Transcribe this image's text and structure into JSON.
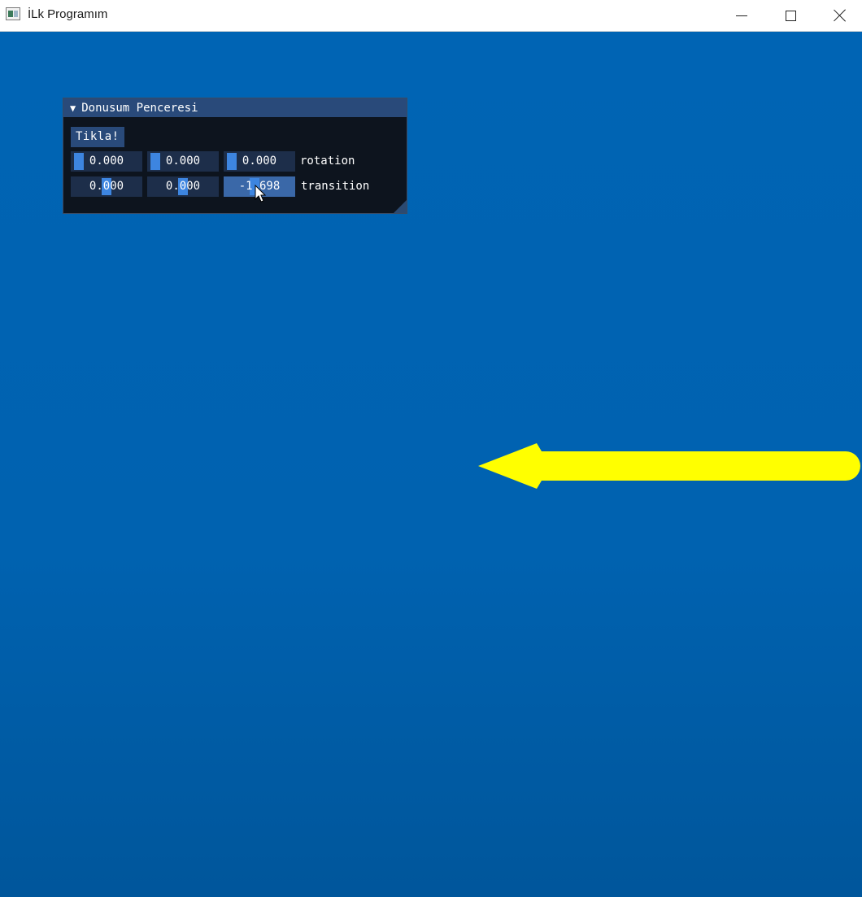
{
  "window": {
    "title": "İLk Programım"
  },
  "imgui": {
    "title": "Donusum Penceresi",
    "button_label": "Tikla!",
    "rotation": {
      "values": [
        "0.000",
        "0.000",
        "0.000"
      ],
      "label": "rotation"
    },
    "transition": {
      "values": [
        "0.000",
        "0.000",
        "-1.698"
      ],
      "label": "transition"
    }
  },
  "colors": {
    "background": "#0063b1",
    "arrow": "#ffff00",
    "imgui_title_bg": "#294a7a",
    "imgui_frame_bg": "#1d2e4a",
    "imgui_grab": "#3d85e0"
  },
  "icons": {
    "minimize": "minimize-icon",
    "maximize": "maximize-icon",
    "close": "close-icon",
    "collapse": "triangle-down-icon",
    "cursor": "mouse-pointer-icon"
  }
}
